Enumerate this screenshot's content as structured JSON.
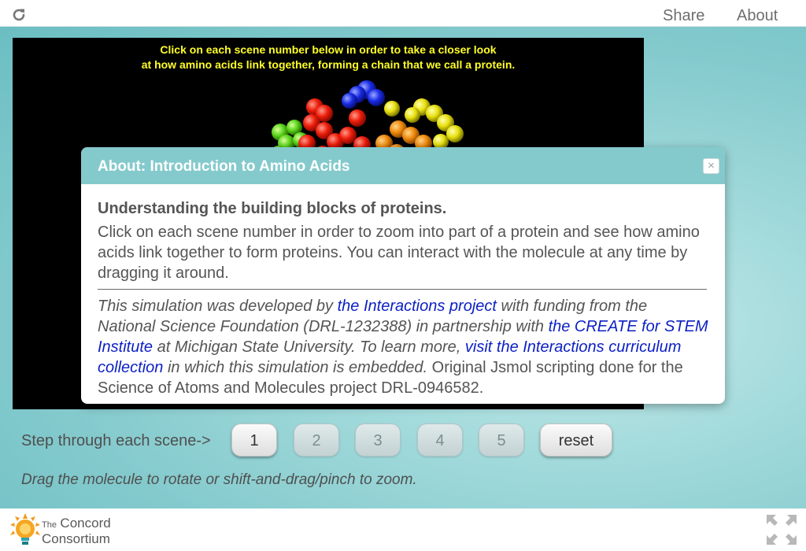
{
  "header": {
    "share_label": "Share",
    "about_label": "About"
  },
  "viewer": {
    "instruction_line1": "Click on each scene number below in order to take a closer look",
    "instruction_line2": "at how amino acids link together, forming a chain that we call a protein."
  },
  "steps": {
    "label": "Step through each scene->",
    "buttons": [
      "1",
      "2",
      "3",
      "4",
      "5"
    ],
    "reset_label": "reset",
    "hint": "Drag the molecule to rotate or shift-and-drag/pinch to zoom."
  },
  "footer": {
    "logo_the": "The",
    "logo_concord": "Concord",
    "logo_consortium": "Consortium"
  },
  "about_dialog": {
    "title": "About: Introduction to Amino Acids",
    "close_label": "×",
    "subtitle": "Understanding the building blocks of proteins.",
    "description": "Click on each scene number in order to zoom into part of a protein and see how amino acids link together to form proteins. You can interact with the molecule at any time by dragging it around.",
    "credit_text_1": "This simulation was developed by ",
    "credit_link_1": "the Interactions project",
    "credit_text_2": " with funding from the National Science Foundation (DRL-1232388) in partnership with ",
    "credit_link_2": "the CREATE for STEM Institute",
    "credit_text_3": " at Michigan State University. To learn more, ",
    "credit_link_3": "visit the Interactions curriculum collection",
    "credit_text_4": " in which this simulation is embedded.",
    "credit_text_5": " Original Jsmol scripting done for the Science of Atoms and Molecules project DRL-0946582."
  },
  "colors": {
    "accent": "#84cacc",
    "instruction_text": "#ffff27",
    "link": "#0b1fc4"
  },
  "icons": {
    "reload": "reload-icon",
    "close": "close-icon",
    "fullscreen": "fullscreen-icon",
    "logo": "concord-bulb-logo"
  }
}
